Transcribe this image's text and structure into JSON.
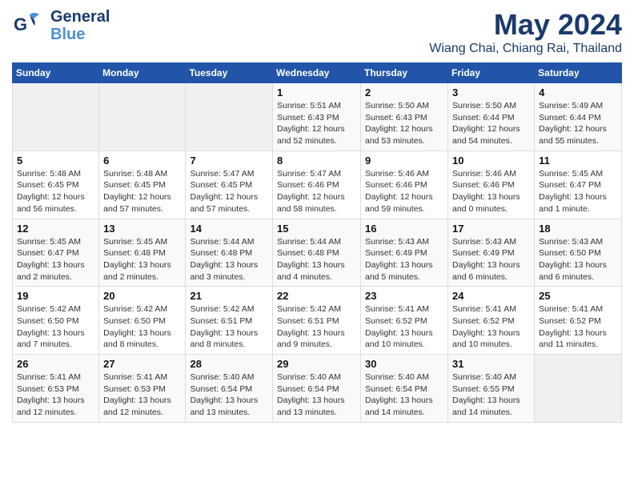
{
  "header": {
    "logo_line1": "General",
    "logo_line2": "Blue",
    "month": "May 2024",
    "location": "Wiang Chai, Chiang Rai, Thailand"
  },
  "weekdays": [
    "Sunday",
    "Monday",
    "Tuesday",
    "Wednesday",
    "Thursday",
    "Friday",
    "Saturday"
  ],
  "weeks": [
    [
      {
        "day": "",
        "empty": true
      },
      {
        "day": "",
        "empty": true
      },
      {
        "day": "",
        "empty": true
      },
      {
        "day": "1",
        "sunrise": "Sunrise: 5:51 AM",
        "sunset": "Sunset: 6:43 PM",
        "daylight": "Daylight: 12 hours and 52 minutes."
      },
      {
        "day": "2",
        "sunrise": "Sunrise: 5:50 AM",
        "sunset": "Sunset: 6:43 PM",
        "daylight": "Daylight: 12 hours and 53 minutes."
      },
      {
        "day": "3",
        "sunrise": "Sunrise: 5:50 AM",
        "sunset": "Sunset: 6:44 PM",
        "daylight": "Daylight: 12 hours and 54 minutes."
      },
      {
        "day": "4",
        "sunrise": "Sunrise: 5:49 AM",
        "sunset": "Sunset: 6:44 PM",
        "daylight": "Daylight: 12 hours and 55 minutes."
      }
    ],
    [
      {
        "day": "5",
        "sunrise": "Sunrise: 5:48 AM",
        "sunset": "Sunset: 6:45 PM",
        "daylight": "Daylight: 12 hours and 56 minutes."
      },
      {
        "day": "6",
        "sunrise": "Sunrise: 5:48 AM",
        "sunset": "Sunset: 6:45 PM",
        "daylight": "Daylight: 12 hours and 57 minutes."
      },
      {
        "day": "7",
        "sunrise": "Sunrise: 5:47 AM",
        "sunset": "Sunset: 6:45 PM",
        "daylight": "Daylight: 12 hours and 57 minutes."
      },
      {
        "day": "8",
        "sunrise": "Sunrise: 5:47 AM",
        "sunset": "Sunset: 6:46 PM",
        "daylight": "Daylight: 12 hours and 58 minutes."
      },
      {
        "day": "9",
        "sunrise": "Sunrise: 5:46 AM",
        "sunset": "Sunset: 6:46 PM",
        "daylight": "Daylight: 12 hours and 59 minutes."
      },
      {
        "day": "10",
        "sunrise": "Sunrise: 5:46 AM",
        "sunset": "Sunset: 6:46 PM",
        "daylight": "Daylight: 13 hours and 0 minutes."
      },
      {
        "day": "11",
        "sunrise": "Sunrise: 5:45 AM",
        "sunset": "Sunset: 6:47 PM",
        "daylight": "Daylight: 13 hours and 1 minute."
      }
    ],
    [
      {
        "day": "12",
        "sunrise": "Sunrise: 5:45 AM",
        "sunset": "Sunset: 6:47 PM",
        "daylight": "Daylight: 13 hours and 2 minutes."
      },
      {
        "day": "13",
        "sunrise": "Sunrise: 5:45 AM",
        "sunset": "Sunset: 6:48 PM",
        "daylight": "Daylight: 13 hours and 2 minutes."
      },
      {
        "day": "14",
        "sunrise": "Sunrise: 5:44 AM",
        "sunset": "Sunset: 6:48 PM",
        "daylight": "Daylight: 13 hours and 3 minutes."
      },
      {
        "day": "15",
        "sunrise": "Sunrise: 5:44 AM",
        "sunset": "Sunset: 6:48 PM",
        "daylight": "Daylight: 13 hours and 4 minutes."
      },
      {
        "day": "16",
        "sunrise": "Sunrise: 5:43 AM",
        "sunset": "Sunset: 6:49 PM",
        "daylight": "Daylight: 13 hours and 5 minutes."
      },
      {
        "day": "17",
        "sunrise": "Sunrise: 5:43 AM",
        "sunset": "Sunset: 6:49 PM",
        "daylight": "Daylight: 13 hours and 6 minutes."
      },
      {
        "day": "18",
        "sunrise": "Sunrise: 5:43 AM",
        "sunset": "Sunset: 6:50 PM",
        "daylight": "Daylight: 13 hours and 6 minutes."
      }
    ],
    [
      {
        "day": "19",
        "sunrise": "Sunrise: 5:42 AM",
        "sunset": "Sunset: 6:50 PM",
        "daylight": "Daylight: 13 hours and 7 minutes."
      },
      {
        "day": "20",
        "sunrise": "Sunrise: 5:42 AM",
        "sunset": "Sunset: 6:50 PM",
        "daylight": "Daylight: 13 hours and 8 minutes."
      },
      {
        "day": "21",
        "sunrise": "Sunrise: 5:42 AM",
        "sunset": "Sunset: 6:51 PM",
        "daylight": "Daylight: 13 hours and 8 minutes."
      },
      {
        "day": "22",
        "sunrise": "Sunrise: 5:42 AM",
        "sunset": "Sunset: 6:51 PM",
        "daylight": "Daylight: 13 hours and 9 minutes."
      },
      {
        "day": "23",
        "sunrise": "Sunrise: 5:41 AM",
        "sunset": "Sunset: 6:52 PM",
        "daylight": "Daylight: 13 hours and 10 minutes."
      },
      {
        "day": "24",
        "sunrise": "Sunrise: 5:41 AM",
        "sunset": "Sunset: 6:52 PM",
        "daylight": "Daylight: 13 hours and 10 minutes."
      },
      {
        "day": "25",
        "sunrise": "Sunrise: 5:41 AM",
        "sunset": "Sunset: 6:52 PM",
        "daylight": "Daylight: 13 hours and 11 minutes."
      }
    ],
    [
      {
        "day": "26",
        "sunrise": "Sunrise: 5:41 AM",
        "sunset": "Sunset: 6:53 PM",
        "daylight": "Daylight: 13 hours and 12 minutes."
      },
      {
        "day": "27",
        "sunrise": "Sunrise: 5:41 AM",
        "sunset": "Sunset: 6:53 PM",
        "daylight": "Daylight: 13 hours and 12 minutes."
      },
      {
        "day": "28",
        "sunrise": "Sunrise: 5:40 AM",
        "sunset": "Sunset: 6:54 PM",
        "daylight": "Daylight: 13 hours and 13 minutes."
      },
      {
        "day": "29",
        "sunrise": "Sunrise: 5:40 AM",
        "sunset": "Sunset: 6:54 PM",
        "daylight": "Daylight: 13 hours and 13 minutes."
      },
      {
        "day": "30",
        "sunrise": "Sunrise: 5:40 AM",
        "sunset": "Sunset: 6:54 PM",
        "daylight": "Daylight: 13 hours and 14 minutes."
      },
      {
        "day": "31",
        "sunrise": "Sunrise: 5:40 AM",
        "sunset": "Sunset: 6:55 PM",
        "daylight": "Daylight: 13 hours and 14 minutes."
      },
      {
        "day": "",
        "empty": true
      }
    ]
  ]
}
